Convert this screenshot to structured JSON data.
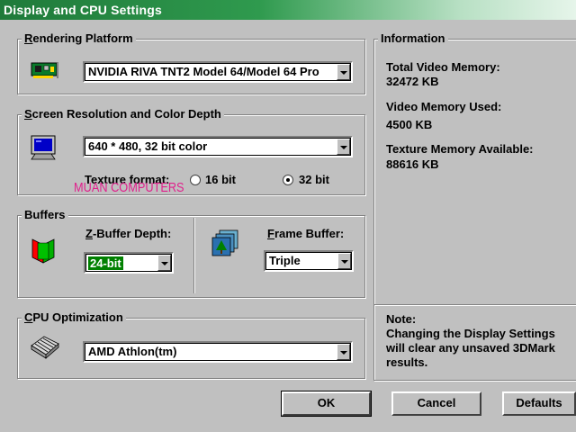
{
  "window": {
    "title": "Display and CPU Settings"
  },
  "rendering": {
    "group_label_first": "R",
    "group_label_rest": "endering Platform",
    "selected": "NVIDIA RIVA TNT2 Model 64/Model 64 Pro"
  },
  "resolution": {
    "group_label_first": "S",
    "group_label_rest": "creen Resolution and Color Depth",
    "selected": "640 * 480, 32 bit color",
    "texture_label": "Texture format:",
    "opt16": "16 bit",
    "opt32": "32 bit",
    "selected_texture": "32 bit"
  },
  "watermark": "MUAN COMPUTERS",
  "buffers": {
    "group_label": "Buffers",
    "zbuffer_label_first": "Z",
    "zbuffer_label_rest": "-Buffer Depth:",
    "zbuffer_value": "24-bit",
    "frame_label_first": "F",
    "frame_label_rest": "rame Buffer:",
    "frame_value": "Triple"
  },
  "cpu": {
    "group_label_first": "C",
    "group_label_rest": "PU Optimization",
    "selected": "AMD Athlon(tm)"
  },
  "information": {
    "group_label": "Information",
    "total_label": "Total Video Memory:",
    "total_value": "32472 KB",
    "used_label": "Video Memory Used:",
    "used_value": "4500 KB",
    "texture_label": "Texture Memory Available:",
    "texture_value": "88616 KB"
  },
  "note": {
    "label": "Note:",
    "line1": "Changing the Display Settings",
    "line2": "will clear any unsaved 3DMark",
    "line3": "results."
  },
  "buttons": {
    "ok": "OK",
    "cancel": "Cancel",
    "defaults": "Defaults"
  },
  "colors": {
    "title_start": "#1f7a3a",
    "face": "#c0c0c0",
    "selection": "#008000",
    "watermark": "#e0208c"
  }
}
